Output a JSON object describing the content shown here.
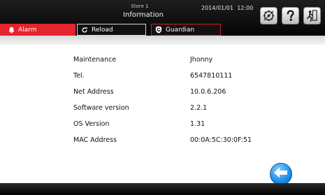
{
  "header": {
    "store": "Store 1",
    "title": "Information",
    "datetime": "2014/01/01  12:00",
    "icons": [
      "network-settings-icon",
      "help-icon",
      "exit-icon"
    ]
  },
  "tabs": [
    {
      "label": "Alarm",
      "icon": "bell-icon",
      "active": true
    },
    {
      "label": "Reload",
      "icon": "reload-icon",
      "active": false
    },
    {
      "label": "Guardian",
      "icon": "guardian-shield-icon",
      "active": false
    }
  ],
  "info": {
    "rows": [
      {
        "label": "Maintenance",
        "value": "Jhonny"
      },
      {
        "label": "Tel.",
        "value": "6547810111"
      },
      {
        "label": "Net Address",
        "value": "10.0.6.206"
      },
      {
        "label": "Software version",
        "value": "2.2.1"
      },
      {
        "label": "OS Version",
        "value": "1.31"
      },
      {
        "label": "MAC Address",
        "value": "00:0A:5C:30:0F:51"
      }
    ]
  },
  "back_button": {
    "icon": "back-arrow-icon"
  },
  "colors": {
    "accent_red": "#e4252e",
    "header_bg": "#0a0a0a",
    "back_blue": "#1c8ee6"
  }
}
